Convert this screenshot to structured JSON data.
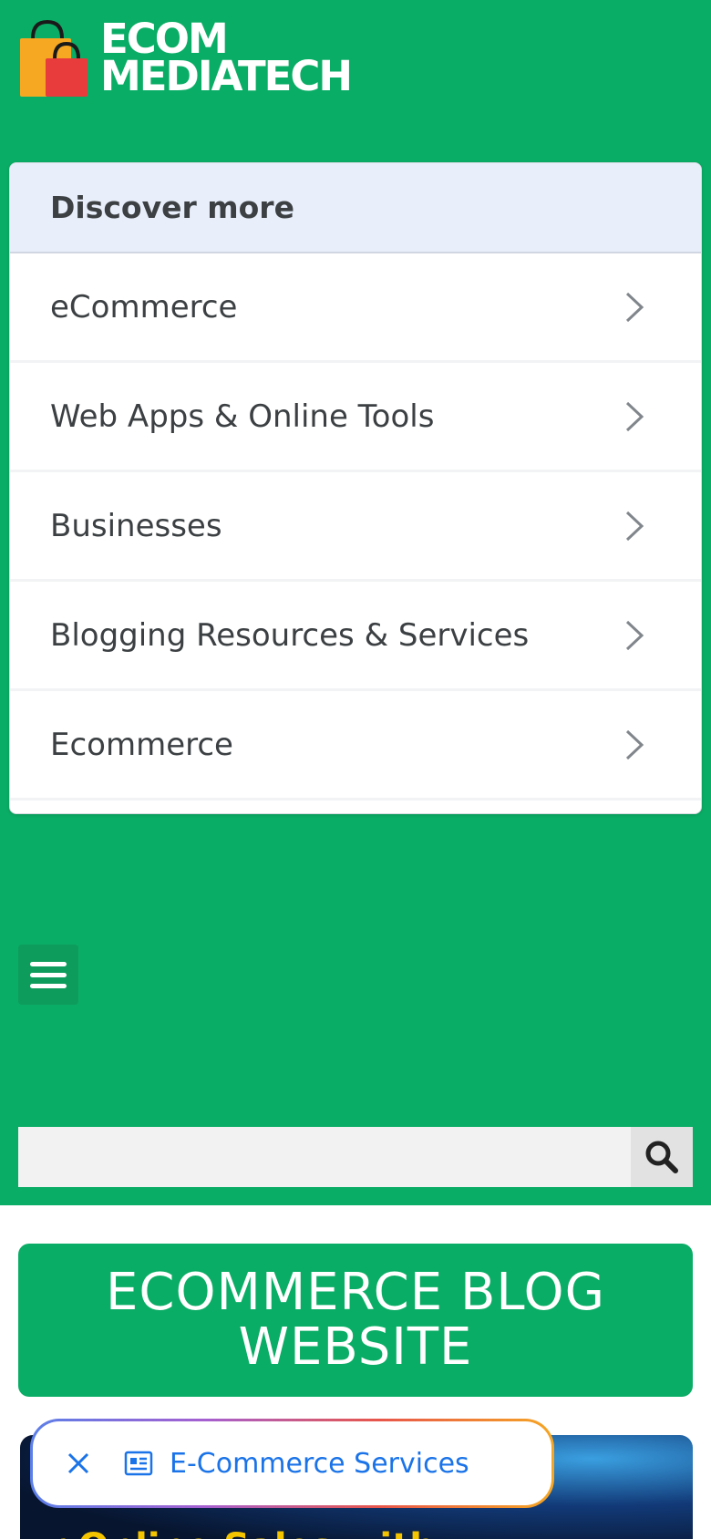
{
  "logo": {
    "line1": "ECOM",
    "line2": "MEDIATECH",
    "icon": "shopping-bags-icon",
    "colors": {
      "bag_back": "#f7a823",
      "bag_front": "#e83b3b"
    }
  },
  "discover": {
    "title": "Discover more",
    "items": [
      {
        "label": "eCommerce"
      },
      {
        "label": "Web Apps & Online Tools"
      },
      {
        "label": "Businesses"
      },
      {
        "label": "Blogging Resources & Services"
      },
      {
        "label": "Ecommerce"
      }
    ]
  },
  "nav": {
    "menu_icon": "hamburger-menu-icon"
  },
  "search": {
    "placeholder": "",
    "value": "",
    "icon": "search-icon"
  },
  "banner": {
    "title": "ECOMMERCE BLOG WEBSITE"
  },
  "hero": {
    "caption": "r Online Sales with"
  },
  "chip": {
    "label": "E-Commerce Services",
    "close_icon": "close-icon",
    "icon": "article-icon"
  },
  "colors": {
    "brand_green": "#0aad65",
    "link_blue": "#1a73e8",
    "discover_header_bg": "#e8effb"
  }
}
